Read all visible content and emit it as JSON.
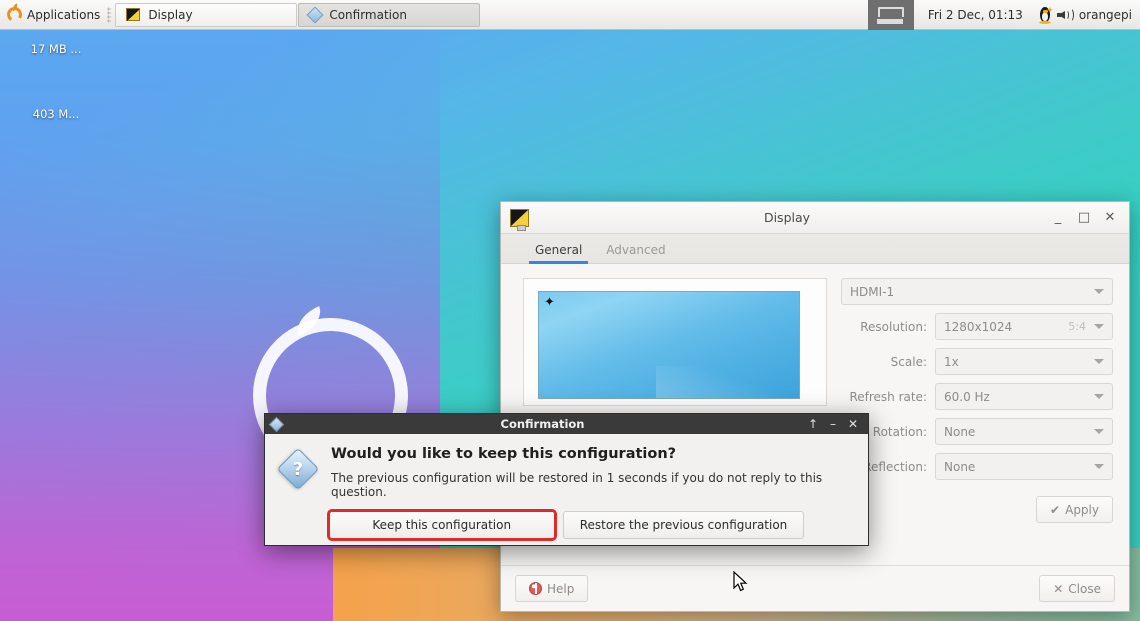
{
  "taskbar": {
    "applications_label": "Applications",
    "buttons": [
      {
        "label": "Display",
        "icon": "display-icon",
        "active": false
      },
      {
        "label": "Confirmation",
        "icon": "diamond-icon",
        "active": true
      }
    ],
    "show_desktop_icon": "show-desktop-icon",
    "clock": "Fri  2 Dec, 01:13",
    "tray": {
      "tux_icon": "tux-penguin-icon",
      "volume_icon": "speaker-volume-icon",
      "username": "orangepi"
    }
  },
  "desktop": {
    "icons": [
      {
        "label": "17 MB ...",
        "icon": "drive-volume-icon"
      },
      {
        "label": "403 M...",
        "icon": "drive-volume-icon"
      }
    ],
    "wallpaper_colors": {
      "blue": "#5aa9f0",
      "teal": "#39cfc0",
      "purple": "#c85cd4",
      "orange": "#f5a24a"
    }
  },
  "display_window": {
    "title": "Display",
    "icon": "display-icon",
    "window_buttons": {
      "minimize": "_",
      "maximize": "□",
      "close": "✕"
    },
    "tabs": [
      {
        "label": "General",
        "active": true
      },
      {
        "label": "Advanced",
        "active": false
      }
    ],
    "output_select": "HDMI-1",
    "fields": [
      {
        "label": "Resolution:",
        "value": "1280x1024",
        "extra": "5:4"
      },
      {
        "label": "Scale:",
        "value": "1x",
        "extra": ""
      },
      {
        "label": "Refresh rate:",
        "value": "60.0 Hz",
        "extra": ""
      },
      {
        "label": "Rotation:",
        "value": "None",
        "extra": ""
      },
      {
        "label": "Reflection:",
        "value": "None",
        "extra": ""
      }
    ],
    "apply_label": "Apply",
    "apply_icon": "check-icon",
    "help_label": "Help",
    "help_icon": "help-icon",
    "close_label": "Close",
    "close_icon": "close-x-icon",
    "preview_marker_icon": "sparkle-icon"
  },
  "confirm_dialog": {
    "title": "Confirmation",
    "title_icon": "diamond-icon",
    "window_buttons": {
      "shade": "↑",
      "minimize": "–",
      "close": "✕"
    },
    "question_icon": "question-mark-icon",
    "heading": "Would you like to keep this configuration?",
    "subtext": "The previous configuration will be restored in 1 seconds if you do not reply to this question.",
    "buttons": [
      {
        "label": "Keep this configuration",
        "highlighted": true
      },
      {
        "label": "Restore the previous configuration",
        "highlighted": false
      }
    ],
    "highlight_color": "#e02b2b"
  }
}
